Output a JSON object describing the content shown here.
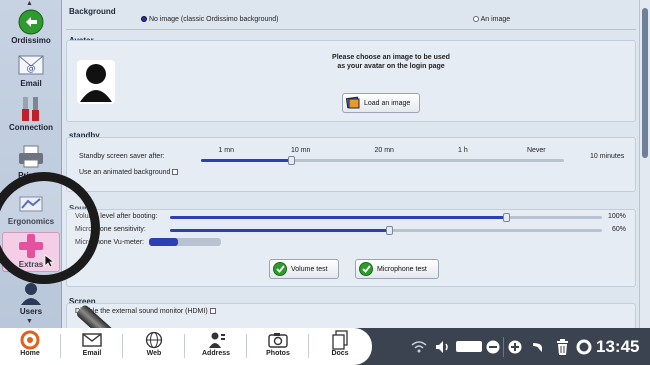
{
  "sidebar": {
    "items": [
      {
        "label": "Ordissimo",
        "icon": "back-arrow-icon"
      },
      {
        "label": "Email",
        "icon": "email-envelope-icon"
      },
      {
        "label": "Connection",
        "icon": "tools-icon"
      },
      {
        "label": "Printer",
        "icon": "printer-icon"
      },
      {
        "label": "Ergonomics",
        "icon": "ergonomics-icon"
      },
      {
        "label": "Extras",
        "icon": "plus-icon"
      },
      {
        "label": "Users",
        "icon": "user-icon"
      }
    ]
  },
  "background": {
    "title": "Background",
    "option_no_image": "No image (classic Ordissimo background)",
    "option_image": "An image",
    "selected": "No image (classic Ordissimo background)"
  },
  "avatar": {
    "title": "Avatar",
    "instruction_line1": "Please choose an image to be used",
    "instruction_line2": "as your avatar on the login page",
    "load_button": "Load an image"
  },
  "standby": {
    "title": "standby",
    "saver_label": "Standby screen saver after:",
    "ticks": [
      "1 mn",
      "10 mn",
      "20 mn",
      "1 h",
      "Never"
    ],
    "value_text": "10 minutes",
    "value_fraction": 0.25,
    "animated_label": "Use an animated background"
  },
  "sound": {
    "title": "Sound",
    "volume_label": "Volume level after booting:",
    "volume_value_text": "100%",
    "volume_fraction": 1.0,
    "mic_label": "Microphone sensitivity:",
    "mic_value_text": "60%",
    "mic_fraction": 0.6,
    "vu_label": "Microphone Vu-meter:",
    "vu_fraction": 0.4,
    "volume_test_button": "Volume test",
    "mic_test_button": "Microphone test"
  },
  "screen": {
    "title": "Screen",
    "hdmi_label": "Disable the external sound monitor (HDMI)"
  },
  "taskbar": {
    "items": [
      {
        "label": "Home",
        "icon": "ordissimo-home-icon"
      },
      {
        "label": "Email",
        "icon": "envelope-icon"
      },
      {
        "label": "Web",
        "icon": "globe-icon"
      },
      {
        "label": "Address",
        "icon": "address-book-icon"
      },
      {
        "label": "Photos",
        "icon": "camera-icon"
      },
      {
        "label": "Docs",
        "icon": "documents-icon"
      }
    ],
    "clock": "13:45"
  },
  "colors": {
    "accent": "#2e3fb3",
    "extras_highlight": "#f2c6e2",
    "taskbar_dark": "#3b4350"
  }
}
